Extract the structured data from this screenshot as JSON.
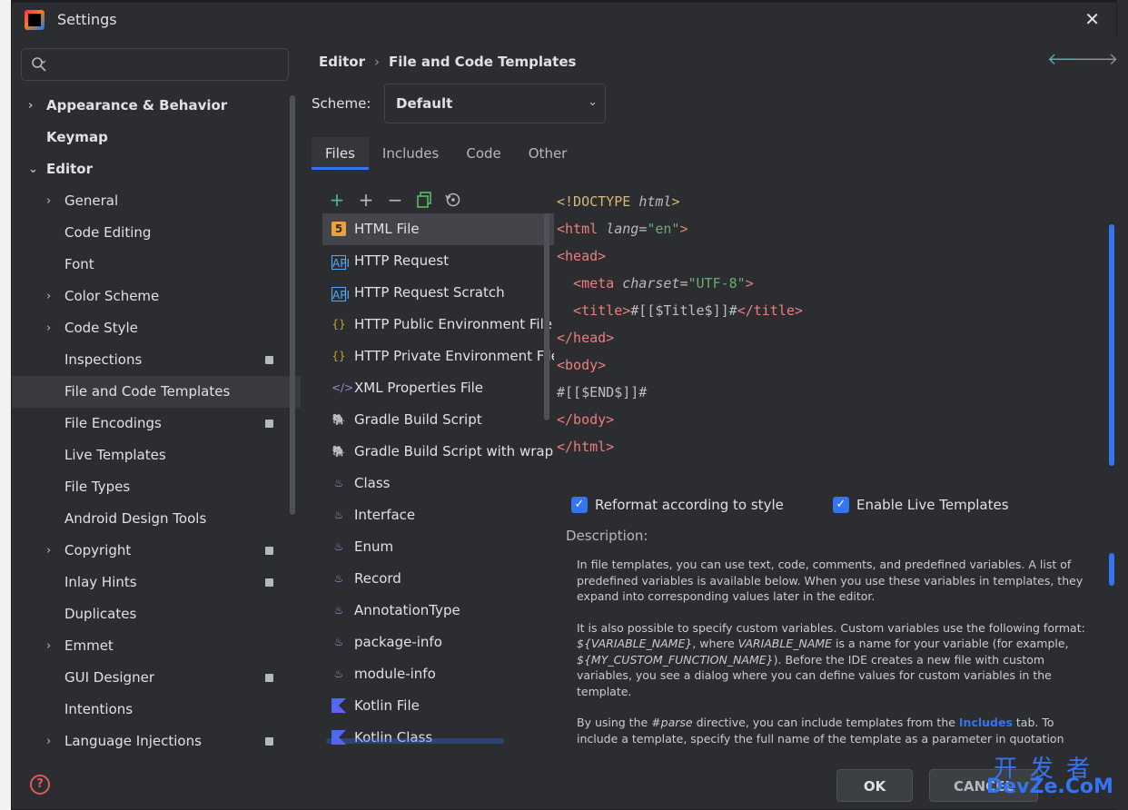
{
  "window": {
    "title": "Settings"
  },
  "search": {
    "placeholder": ""
  },
  "sidebar": {
    "items": [
      {
        "label": "Appearance & Behavior",
        "level": 0,
        "chevron": "›",
        "bold": true,
        "badge": false
      },
      {
        "label": "Keymap",
        "level": 0,
        "chevron": "",
        "bold": true,
        "badge": false
      },
      {
        "label": "Editor",
        "level": 0,
        "chevron": "⌄",
        "bold": true,
        "badge": false
      },
      {
        "label": "General",
        "level": 1,
        "chevron": "›",
        "badge": false
      },
      {
        "label": "Code Editing",
        "level": 1,
        "chevron": "",
        "badge": false
      },
      {
        "label": "Font",
        "level": 1,
        "chevron": "",
        "badge": false
      },
      {
        "label": "Color Scheme",
        "level": 1,
        "chevron": "›",
        "badge": false
      },
      {
        "label": "Code Style",
        "level": 1,
        "chevron": "›",
        "badge": false
      },
      {
        "label": "Inspections",
        "level": 1,
        "chevron": "",
        "badge": true
      },
      {
        "label": "File and Code Templates",
        "level": 1,
        "chevron": "",
        "badge": false,
        "selected": true
      },
      {
        "label": "File Encodings",
        "level": 1,
        "chevron": "",
        "badge": true
      },
      {
        "label": "Live Templates",
        "level": 1,
        "chevron": "",
        "badge": false
      },
      {
        "label": "File Types",
        "level": 1,
        "chevron": "",
        "badge": false
      },
      {
        "label": "Android Design Tools",
        "level": 1,
        "chevron": "",
        "badge": false
      },
      {
        "label": "Copyright",
        "level": 1,
        "chevron": "›",
        "badge": true
      },
      {
        "label": "Inlay Hints",
        "level": 1,
        "chevron": "",
        "badge": true
      },
      {
        "label": "Duplicates",
        "level": 1,
        "chevron": "",
        "badge": false
      },
      {
        "label": "Emmet",
        "level": 1,
        "chevron": "›",
        "badge": false
      },
      {
        "label": "GUI Designer",
        "level": 1,
        "chevron": "",
        "badge": true
      },
      {
        "label": "Intentions",
        "level": 1,
        "chevron": "",
        "badge": false
      },
      {
        "label": "Language Injections",
        "level": 1,
        "chevron": "›",
        "badge": true
      }
    ]
  },
  "breadcrumb": {
    "parent": "Editor",
    "separator": "›",
    "current": "File and Code Templates"
  },
  "scheme": {
    "label": "Scheme:",
    "value": "Default"
  },
  "tabs": [
    "Files",
    "Includes",
    "Code",
    "Other"
  ],
  "file_list": [
    {
      "label": "HTML File",
      "icon": "html5-icon",
      "selected": true
    },
    {
      "label": "HTTP Request",
      "icon": "api-icon"
    },
    {
      "label": "HTTP Request Scratch",
      "icon": "api-icon"
    },
    {
      "label": "HTTP Public Environment File",
      "icon": "json-braces-icon"
    },
    {
      "label": "HTTP Private Environment File",
      "icon": "json-braces-icon"
    },
    {
      "label": "XML Properties File",
      "icon": "xml-icon"
    },
    {
      "label": "Gradle Build Script",
      "icon": "gradle-icon"
    },
    {
      "label": "Gradle Build Script with wrapper",
      "icon": "gradle-icon"
    },
    {
      "label": "Class",
      "icon": "java-icon"
    },
    {
      "label": "Interface",
      "icon": "java-icon"
    },
    {
      "label": "Enum",
      "icon": "java-icon"
    },
    {
      "label": "Record",
      "icon": "java-icon"
    },
    {
      "label": "AnnotationType",
      "icon": "java-icon"
    },
    {
      "label": "package-info",
      "icon": "java-icon"
    },
    {
      "label": "module-info",
      "icon": "java-icon"
    },
    {
      "label": "Kotlin File",
      "icon": "kotlin-icon"
    },
    {
      "label": "Kotlin Class",
      "icon": "kotlin-icon"
    }
  ],
  "code": {
    "l1_open": "<!DOCTYPE ",
    "l1_attr": "html",
    "l1_close": ">",
    "l2_open": "<html ",
    "l2_attr": "lang",
    "l2_eq": "=",
    "l2_str": "\"en\"",
    "l2_close": ">",
    "l3": "<head>",
    "l4_open": "  <meta ",
    "l4_attr": "charset",
    "l4_eq": "=",
    "l4_str": "\"UTF-8\"",
    "l4_close": ">",
    "l5_open": "  <title>",
    "l5_text": "#[[$Title$]]#",
    "l5_close": "</title>",
    "l6": "</head>",
    "l7": "<body>",
    "l8": "#[[$END$]]#",
    "l9": "</body>",
    "l10": "</html>"
  },
  "options": {
    "reformat": "Reformat according to style",
    "live_templates": "Enable Live Templates"
  },
  "description": {
    "label": "Description:",
    "p1": "In file templates, you can use text, code, comments, and predefined variables. A list of predefined variables is available below. When you use these variables in templates, they expand into corresponding values later in the editor.",
    "p2_a": "It is also possible to specify custom variables. Custom variables use the following format: ",
    "p2_var1": "${VARIABLE_NAME}",
    "p2_b": ", where ",
    "p2_var2": "VARIABLE_NAME",
    "p2_c": " is a name for your variable (for example, ",
    "p2_var3": "${MY_CUSTOM_FUNCTION_NAME}",
    "p2_d": "). Before the IDE creates a new file with custom variables, you see a dialog where you can define values for custom variables in the template.",
    "p3_a": "By using the ",
    "p3_var": "#parse",
    "p3_b": " directive, you can include templates from the ",
    "p3_inc": "Includes",
    "p3_c": " tab. To include a template, specify the full name of the template as a parameter in quotation"
  },
  "buttons": {
    "ok": "OK",
    "cancel": "CANCEL"
  },
  "watermark": {
    "cn": "开发者",
    "en": "DevZe.CoM"
  },
  "colors": {
    "accent": "#3574f0",
    "background": "#2b2d30",
    "selected": "#43454a"
  }
}
